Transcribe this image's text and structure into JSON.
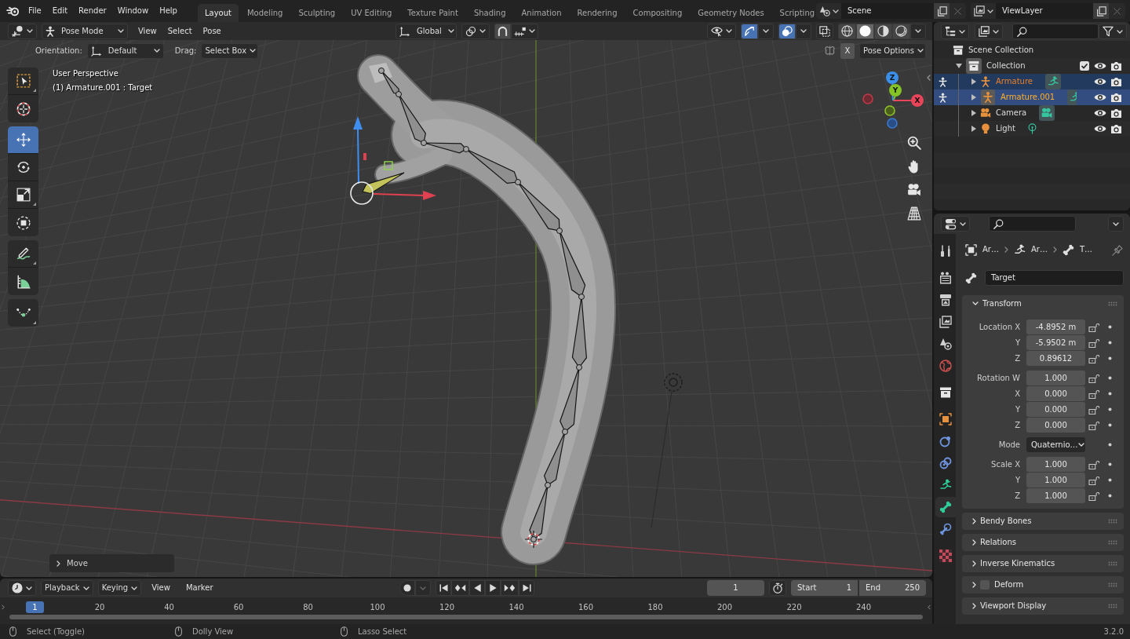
{
  "topbar": {
    "menus": [
      "File",
      "Edit",
      "Render",
      "Window",
      "Help"
    ],
    "workspaces": [
      {
        "label": "Layout",
        "selected": true
      },
      {
        "label": "Modeling",
        "selected": false
      },
      {
        "label": "Sculpting",
        "selected": false
      },
      {
        "label": "UV Editing",
        "selected": false
      },
      {
        "label": "Texture Paint",
        "selected": false
      },
      {
        "label": "Shading",
        "selected": false
      },
      {
        "label": "Animation",
        "selected": false
      },
      {
        "label": "Rendering",
        "selected": false
      },
      {
        "label": "Compositing",
        "selected": false
      },
      {
        "label": "Geometry Nodes",
        "selected": false
      },
      {
        "label": "Scripting",
        "selected": false
      }
    ],
    "scene": "Scene",
    "view_layer": "ViewLayer"
  },
  "viewport": {
    "header": {
      "mode": "Pose Mode",
      "menus": [
        "View",
        "Select",
        "Pose"
      ],
      "orientation": "Global",
      "gizmos_on": true,
      "overlays_on": true,
      "xray_on": false,
      "shading": [
        {
          "kind": "wireframe",
          "selected": false
        },
        {
          "kind": "solid",
          "selected": true
        },
        {
          "kind": "material",
          "selected": false
        },
        {
          "kind": "rendered",
          "selected": false
        }
      ]
    },
    "tool_settings": {
      "orientation_label": "Orientation:",
      "orientation": "Default",
      "drag_label": "Drag:",
      "drag": "Select Box",
      "mirror_axis": "X",
      "pose_options": "Pose Options"
    },
    "toolbar": {
      "groups": [
        {
          "tools": [
            {
              "kind": "select_box",
              "selected": false,
              "has_variants": true
            },
            {
              "kind": "cursor",
              "selected": false,
              "has_variants": false
            }
          ]
        },
        {
          "tools": [
            {
              "kind": "move",
              "selected": true,
              "has_variants": false
            },
            {
              "kind": "rotate",
              "selected": false,
              "has_variants": false
            },
            {
              "kind": "scale",
              "selected": false,
              "has_variants": true
            },
            {
              "kind": "transform",
              "selected": false,
              "has_variants": false
            }
          ]
        },
        {
          "tools": [
            {
              "kind": "annotate",
              "selected": false,
              "has_variants": true
            },
            {
              "kind": "measure",
              "selected": false,
              "has_variants": false
            }
          ]
        },
        {
          "tools": [
            {
              "kind": "relax",
              "selected": false,
              "has_variants": true
            }
          ]
        }
      ]
    },
    "info": [
      "User Perspective",
      "(1) Armature.001 : Target"
    ],
    "axis_labels": [
      "X",
      "Y",
      "Z"
    ],
    "last_operator": {
      "label": "Move",
      "expanded": false
    }
  },
  "outliner": {
    "tree": [
      {
        "label": "Scene Collection",
        "kind": "scene_collection",
        "selected": false,
        "active": false,
        "children": [
          {
            "label": "Collection",
            "kind": "collection",
            "selected": false,
            "active": true,
            "expanded": true,
            "checked": true,
            "visible": true,
            "renderable": true,
            "children": [
              {
                "label": "Armature",
                "kind": "armature",
                "selected": true,
                "active": false,
                "expanded": false,
                "pose_mode": true,
                "visible": true,
                "renderable": true
              },
              {
                "label": "Armature.001",
                "kind": "armature",
                "selected": true,
                "active": true,
                "expanded": false,
                "pose_mode": true,
                "visible": true,
                "renderable": true
              },
              {
                "label": "Camera",
                "kind": "camera",
                "selected": false,
                "active": false,
                "expanded": false,
                "pose_mode": false,
                "visible": true,
                "renderable": true
              },
              {
                "label": "Light",
                "kind": "light",
                "selected": false,
                "active": false,
                "expanded": false,
                "pose_mode": false,
                "visible": true,
                "renderable": true
              }
            ]
          }
        ]
      }
    ]
  },
  "properties": {
    "tab_groups": [
      {
        "tabs": [
          {
            "kind": "tool",
            "selected": false
          }
        ]
      },
      {
        "tabs": [
          {
            "kind": "render",
            "selected": false
          },
          {
            "kind": "output",
            "selected": false
          },
          {
            "kind": "view_layer",
            "selected": false
          },
          {
            "kind": "scene",
            "selected": false
          },
          {
            "kind": "world",
            "selected": false
          }
        ]
      },
      {
        "tabs": [
          {
            "kind": "collection",
            "selected": false
          }
        ]
      },
      {
        "tabs": [
          {
            "kind": "object",
            "selected": false
          },
          {
            "kind": "physics",
            "selected": false
          },
          {
            "kind": "object_constraints",
            "selected": false
          },
          {
            "kind": "data",
            "selected": false
          },
          {
            "kind": "bone",
            "selected": true
          },
          {
            "kind": "bone_constraints",
            "selected": false
          }
        ]
      },
      {
        "tabs": [
          {
            "kind": "texture",
            "selected": false
          }
        ]
      }
    ],
    "breadcrumb": [
      "Ar…",
      "Ar…",
      "T…"
    ],
    "name": "Target",
    "panels": [
      {
        "title": "Transform",
        "expanded": true,
        "groups": [
          {
            "rows": [
              {
                "label": "Location X",
                "value": "-4.8952 m",
                "kind": "number",
                "locked": false
              },
              {
                "label": "Y",
                "value": "-5.9502 m",
                "kind": "number",
                "locked": false
              },
              {
                "label": "Z",
                "value": "0.89612",
                "kind": "number",
                "locked": false
              }
            ]
          },
          {
            "rows": [
              {
                "label": "Rotation W",
                "value": "1.000",
                "kind": "number",
                "locked": false
              },
              {
                "label": "X",
                "value": "0.000",
                "kind": "number",
                "locked": false
              },
              {
                "label": "Y",
                "value": "0.000",
                "kind": "number",
                "locked": false
              },
              {
                "label": "Z",
                "value": "0.000",
                "kind": "number",
                "locked": false
              }
            ]
          },
          {
            "rows": [
              {
                "label": "Mode",
                "value": "Quaternio…",
                "kind": "dropdown"
              }
            ]
          },
          {
            "rows": [
              {
                "label": "Scale X",
                "value": "1.000",
                "kind": "number",
                "locked": false
              },
              {
                "label": "Y",
                "value": "1.000",
                "kind": "number",
                "locked": false
              },
              {
                "label": "Z",
                "value": "1.000",
                "kind": "number",
                "locked": false
              }
            ]
          }
        ]
      },
      {
        "title": "Bendy Bones",
        "expanded": false
      },
      {
        "title": "Relations",
        "expanded": false
      },
      {
        "title": "Inverse Kinematics",
        "expanded": false
      },
      {
        "title": "Deform",
        "expanded": false,
        "checked": false
      },
      {
        "title": "Viewport Display",
        "expanded": false
      }
    ]
  },
  "timeline": {
    "menus": [
      {
        "label": "Playback",
        "kind": "dropdown"
      },
      {
        "label": "Keying",
        "kind": "dropdown"
      },
      {
        "label": "View",
        "kind": "menu"
      },
      {
        "label": "Marker",
        "kind": "menu"
      }
    ],
    "current_frame": "1",
    "start_label": "Start",
    "start": "1",
    "end_label": "End",
    "end": "250",
    "playhead": "1",
    "ticks": [
      "20",
      "40",
      "60",
      "80",
      "100",
      "120",
      "140",
      "160",
      "180",
      "200",
      "220",
      "240"
    ]
  },
  "status_bar": {
    "hints": [
      "Select (Toggle)",
      "Dolly View",
      "Lasso Select"
    ],
    "version": "3.2.0"
  }
}
